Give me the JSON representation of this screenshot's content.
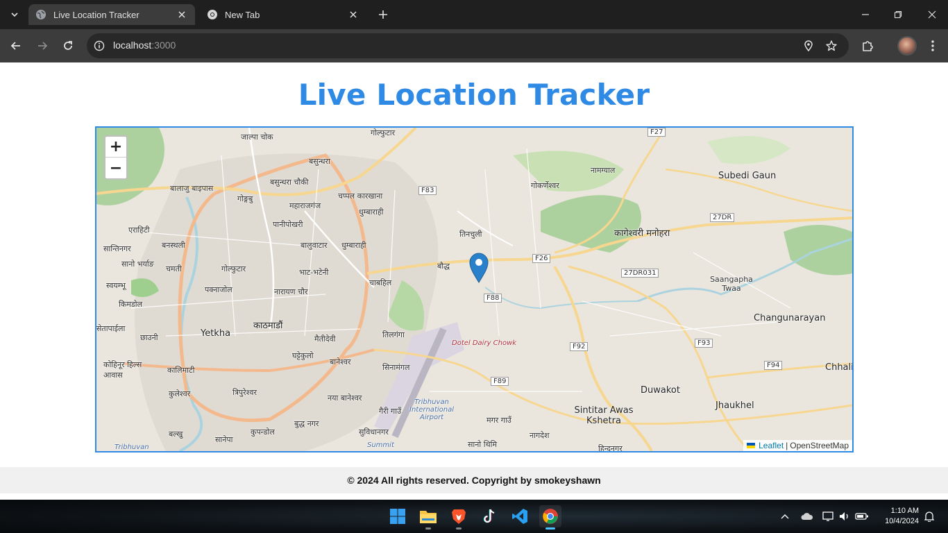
{
  "browser": {
    "tabs": [
      {
        "title": "Live Location Tracker",
        "active": true
      },
      {
        "title": "New Tab",
        "active": false
      }
    ],
    "url_host": "localhost",
    "url_port": ":3000"
  },
  "page": {
    "title": "Live Location Tracker",
    "footer": "© 2024 All rights reserved. Copyright by smokeyshawn"
  },
  "map": {
    "zoom_in": "+",
    "zoom_out": "−",
    "attribution": {
      "leaflet": "Leaflet",
      "separator": "|",
      "osm": "OpenStreetMap"
    },
    "labels": {
      "l1": "जाल्पा चोक",
      "l2": "गोल्फुटार",
      "l3": "बसुन्धरा",
      "l4": "बसुन्धरा चौकी",
      "l5": "बालाजु बाइपास",
      "l6": "गोङ्गबु",
      "l7": "महाराजगंज",
      "l8": "चप्पल कारखाना",
      "l9": "धुम्बाराही",
      "l10": "पानीपोखरी",
      "l11": "एराहिटी",
      "l12": "सान्तिनगर",
      "l13": "बनस्थली",
      "l14": "सानो भर्याङ",
      "l15": "चमती",
      "l16": "गोल्फुटार",
      "l17": "बालुवाटार",
      "l18": "धुम्बाराही",
      "l19": "भाट-भटेनी",
      "l20": "स्वयम्भू",
      "l21": "पक्नाजोल",
      "l22": "नारायण चौर",
      "l23": "चाबहिल",
      "l24": "बौद्ध",
      "l25": "तिनचुली",
      "l26": "किमडोल",
      "l27": "काठमाडौं",
      "l28": "Yetkha",
      "l29": "सेतापाईला",
      "l30": "छाउनी",
      "l31": "मैतीदेवी",
      "l32": "तिलगंगा",
      "l33": "घट्टेकुलो",
      "l34": "बानेश्वर",
      "l35": "सिनामंगल",
      "l36": "कोहिनूर हिल्स आवास",
      "l37": "कालिमाटी",
      "l38": "कुलेश्वर",
      "l39": "त्रिपुरेश्वर",
      "l40": "नया बानेश्वर",
      "l41": "गैरी गाउँ",
      "l42": "बुद्ध नगर",
      "l43": "कुपन्डोल",
      "l44": "बल्खु",
      "l45": "सानेपा",
      "l46": "सुविधानगर",
      "l47": "सानो थिमि",
      "l48": "मगर गाउँ",
      "l49": "नागदेश",
      "l50": "गोकर्णेश्वर",
      "l51": "नामग्याल",
      "l52": "Subedi Gaun",
      "l53": "कागेश्वरी मनोहरा",
      "l54": "Saangapha Twaa",
      "l55": "Changunarayan",
      "l56": "Chhali",
      "l57": "Duwakot",
      "l58": "Jhaukhel",
      "l59": "Sintitar Awas Kshetra",
      "l60": "हिन्दनगर",
      "l61": "Dotel Dairy Chowk",
      "l62": "Tribhuvan International Airport",
      "l63": "Summit",
      "l64": "Tribhuvan"
    },
    "roads": {
      "r1": "F27",
      "r2": "F83",
      "r3": "F26",
      "r4": "F88",
      "r5": "27DR031",
      "r6": "F92",
      "r7": "F93",
      "r8": "F94",
      "r9": "F89",
      "r10": "27DR"
    }
  },
  "taskbar": {
    "time": "1:10 AM",
    "date": "10/4/2024"
  },
  "colors": {
    "accent": "#2f8ae5",
    "chrome_dark": "#1f1f1f",
    "chrome_toolbar": "#3c3c3c",
    "footer_bg": "#f0f0f0"
  }
}
